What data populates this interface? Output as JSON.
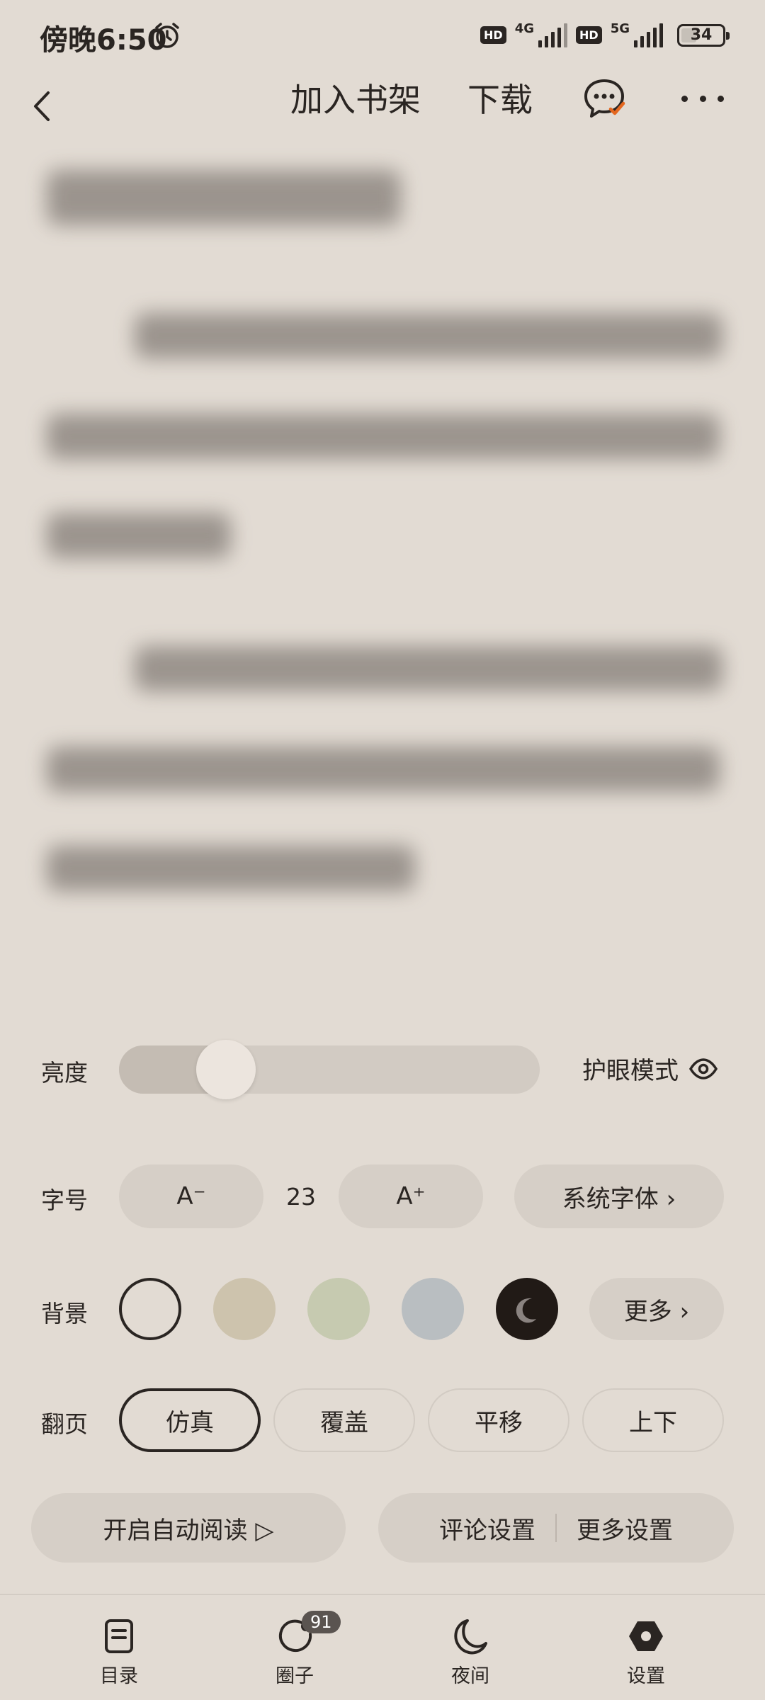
{
  "status_bar": {
    "time": "傍晚6:50",
    "network_1": "4G",
    "network_2": "5G",
    "hd_label": "HD",
    "battery": "34"
  },
  "top_bar": {
    "add_to_shelf": "加入书架",
    "download": "下载"
  },
  "settings": {
    "brightness_label": "亮度",
    "brightness_level": 0.2,
    "eye_mode_label": "护眼模式",
    "font_size_label": "字号",
    "font_decrease": "A⁻",
    "font_increase": "A⁺",
    "font_size_value": "23",
    "system_font": "系统字体 ›",
    "background_label": "背景",
    "background_colors": [
      "#e2dbd3",
      "#cdc3ad",
      "#c6cab0",
      "#b9bec1",
      "#211a16"
    ],
    "background_more": "更多 ›",
    "page_turn_label": "翻页",
    "page_turn_options": [
      "仿真",
      "覆盖",
      "平移",
      "上下"
    ],
    "auto_read": "开启自动阅读 ▷",
    "comment_settings": "评论设置",
    "more_settings": "更多设置"
  },
  "bottom_nav": {
    "items": [
      {
        "label": "目录",
        "icon": "toc-icon"
      },
      {
        "label": "圈子",
        "icon": "circle-icon",
        "badge": "91"
      },
      {
        "label": "夜间",
        "icon": "moon-icon"
      },
      {
        "label": "设置",
        "icon": "settings-icon"
      }
    ]
  }
}
